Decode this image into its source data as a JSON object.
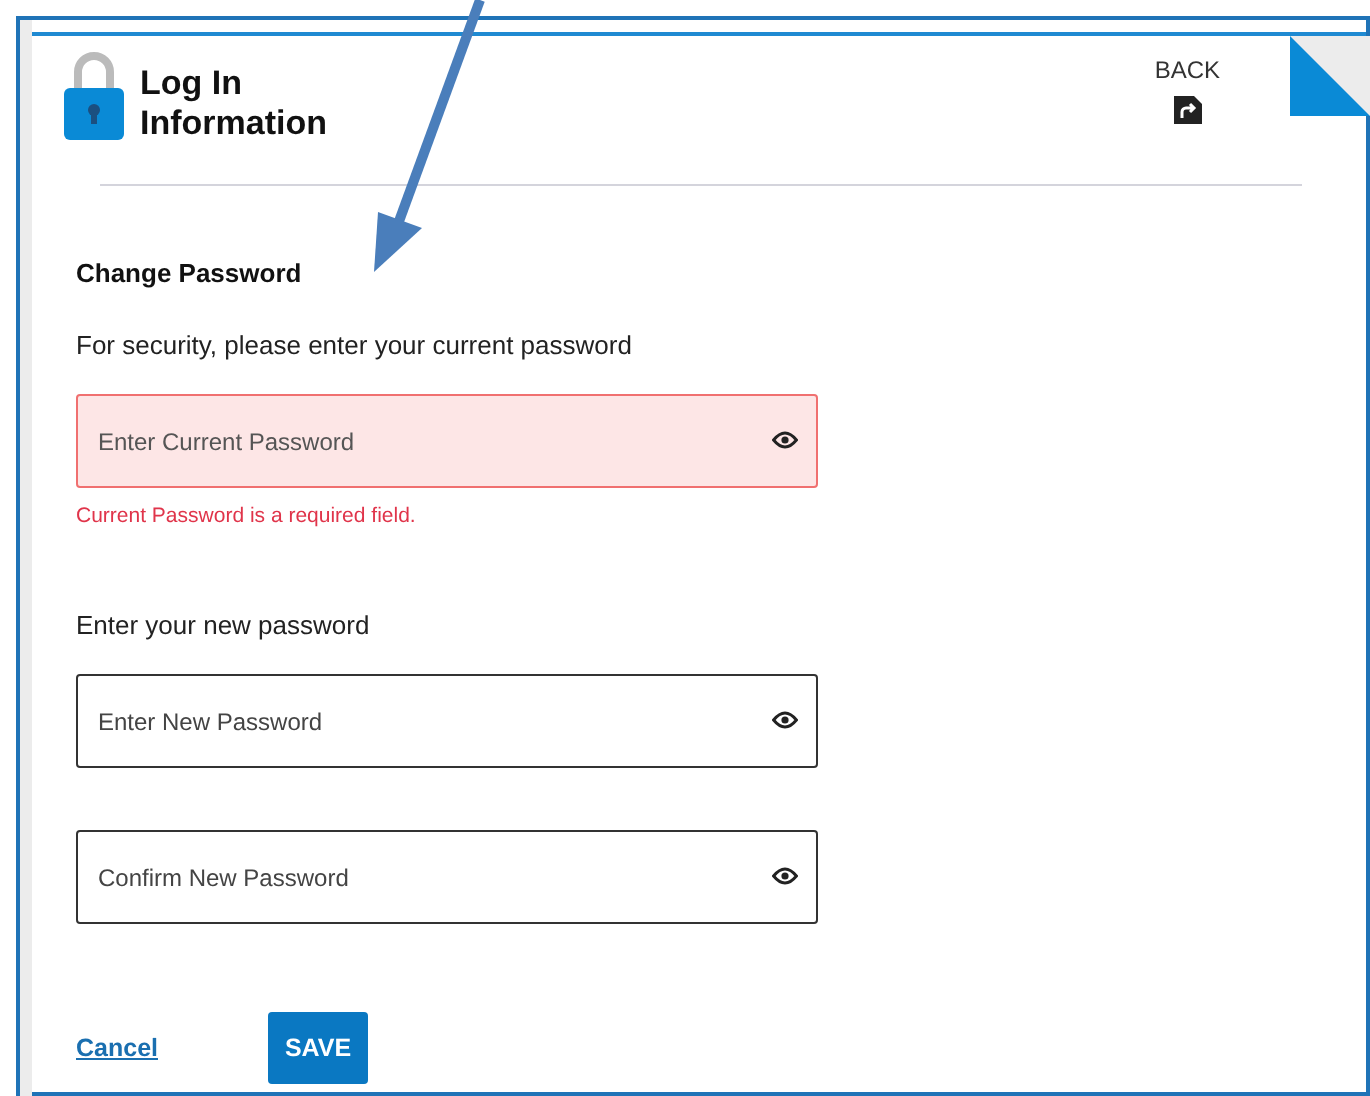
{
  "header": {
    "title": "Log In Information",
    "back_label": "BACK"
  },
  "section_title": "Change Password",
  "groups": [
    {
      "prompt": "For security, please enter your current password",
      "fields": [
        {
          "placeholder": "Enter Current Password",
          "invalid": true,
          "error": "Current Password is a required field."
        }
      ]
    },
    {
      "prompt": "Enter your new password",
      "fields": [
        {
          "placeholder": "Enter New Password",
          "invalid": false
        },
        {
          "placeholder": "Confirm New Password",
          "invalid": false
        }
      ]
    }
  ],
  "actions": {
    "cancel": "Cancel",
    "save": "SAVE"
  }
}
